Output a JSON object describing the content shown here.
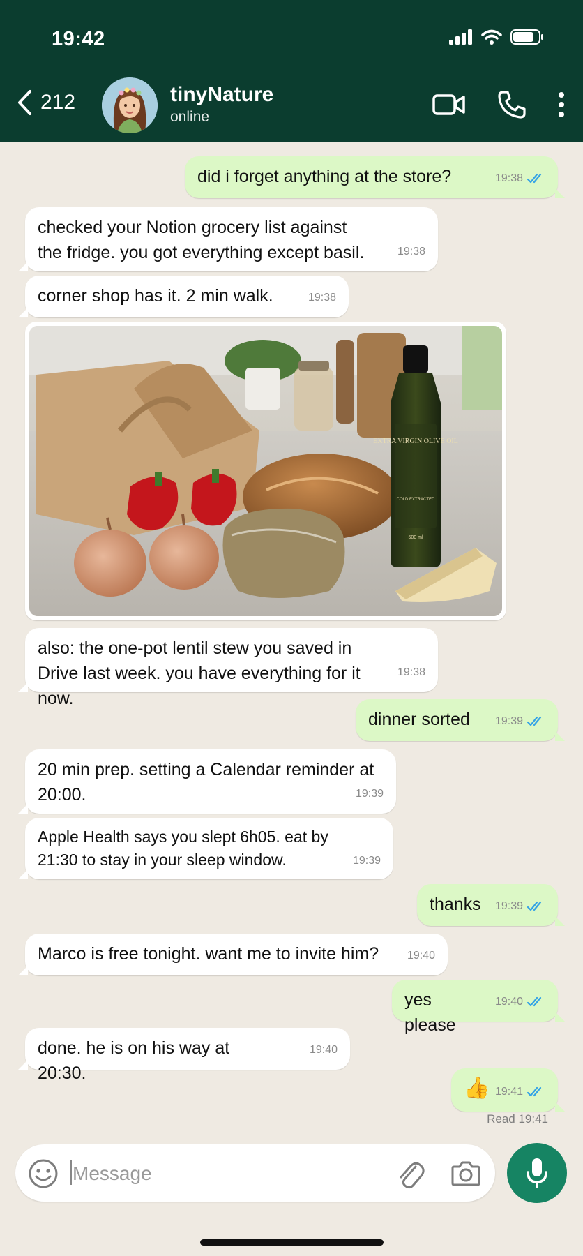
{
  "status_bar": {
    "time": "19:42"
  },
  "header": {
    "back_count": "212",
    "contact_name": "tinyNature",
    "contact_status": "online"
  },
  "messages": [
    {
      "dir": "out",
      "text": "did i forget anything at the store?",
      "time": "19:38",
      "ticks": "read"
    },
    {
      "dir": "in",
      "text": "checked your Notion grocery list against the fridge. you got everything except basil.",
      "time": "19:38"
    },
    {
      "dir": "in",
      "text": "corner shop has it. 2 min walk.",
      "time": "19:38"
    },
    {
      "dir": "in",
      "type": "image",
      "label": "EXTRA VIRGIN OLIVE OIL",
      "sublabel": "COLD EXTRACTED",
      "volume": "500 ml"
    },
    {
      "dir": "in",
      "text": "also: the one-pot lentil stew you saved in Drive last week. you have everything for it now.",
      "time": "19:38"
    },
    {
      "dir": "out",
      "text": "dinner sorted",
      "time": "19:39",
      "ticks": "read"
    },
    {
      "dir": "in",
      "text": "20 min prep. setting a Calendar reminder at 20:00.",
      "time": "19:39"
    },
    {
      "dir": "in",
      "text": "Apple Health says you slept 6h05. eat by 21:30 to stay in your sleep window.",
      "time": "19:39"
    },
    {
      "dir": "out",
      "text": "thanks",
      "time": "19:39",
      "ticks": "read"
    },
    {
      "dir": "in",
      "text": "Marco is free tonight. want me to invite him?",
      "time": "19:40"
    },
    {
      "dir": "out",
      "text": "yes please",
      "time": "19:40",
      "ticks": "read"
    },
    {
      "dir": "in",
      "text": "done. he is on his way at 20:30.",
      "time": "19:40"
    },
    {
      "dir": "out",
      "text": "👍",
      "time": "19:41",
      "ticks": "read"
    }
  ],
  "read_receipt": "Read 19:41",
  "composer": {
    "placeholder": "Message"
  },
  "colors": {
    "header_bg": "#0b3d2f",
    "chat_bg": "#efeae2",
    "outgoing_bubble": "#dcf8c6",
    "incoming_bubble": "#ffffff",
    "read_tick": "#34a3e6",
    "mic_button": "#168463"
  },
  "icons": [
    "signal-icon",
    "wifi-icon",
    "battery-icon",
    "back-chevron-icon",
    "video-call-icon",
    "phone-icon",
    "more-options-icon",
    "read-ticks-icon",
    "emoji-icon",
    "attach-icon",
    "camera-icon",
    "mic-icon"
  ]
}
